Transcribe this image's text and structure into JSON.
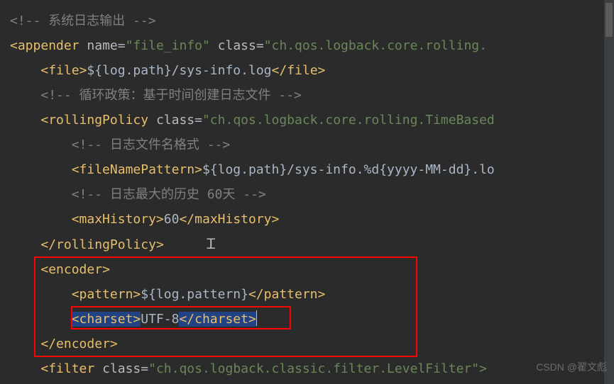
{
  "lines": {
    "l1_comment": "<!-- 系统日志输出 -->",
    "l2": {
      "tag": "appender",
      "attr1n": "name",
      "attr1v": "\"file_info\"",
      "attr2n": "class",
      "attr2v": "\"ch.qos.logback.core.rolling."
    },
    "l3": {
      "open": "file",
      "text": "${log.path}/sys-info.log",
      "close": "file"
    },
    "l4_comment": "<!-- 循环政策：基于时间创建日志文件 -->",
    "l5": {
      "tag": "rollingPolicy",
      "attr1n": "class",
      "attr1v": "\"ch.qos.logback.core.rolling.TimeBased"
    },
    "l6_comment": "<!-- 日志文件名格式 -->",
    "l7": {
      "open": "fileNamePattern",
      "text": "${log.path}/sys-info.%d{yyyy-MM-dd}.lo"
    },
    "l8_comment": "<!-- 日志最大的历史 60天 -->",
    "l9": {
      "open": "maxHistory",
      "text": "60",
      "close": "maxHistory"
    },
    "l10_close": "rollingPolicy",
    "l11_open": "encoder",
    "l12": {
      "open": "pattern",
      "text": "${log.pattern}",
      "close": "pattern"
    },
    "l13": {
      "open": "charset",
      "text": "UTF-8",
      "close": "charset"
    },
    "l14_close": "encoder",
    "l15": {
      "tag": "filter",
      "attr1n": "class",
      "attr1v": "\"ch.qos.logback.classic.filter.LevelFilter\">"
    }
  },
  "watermark": "CSDN @翟文彪"
}
